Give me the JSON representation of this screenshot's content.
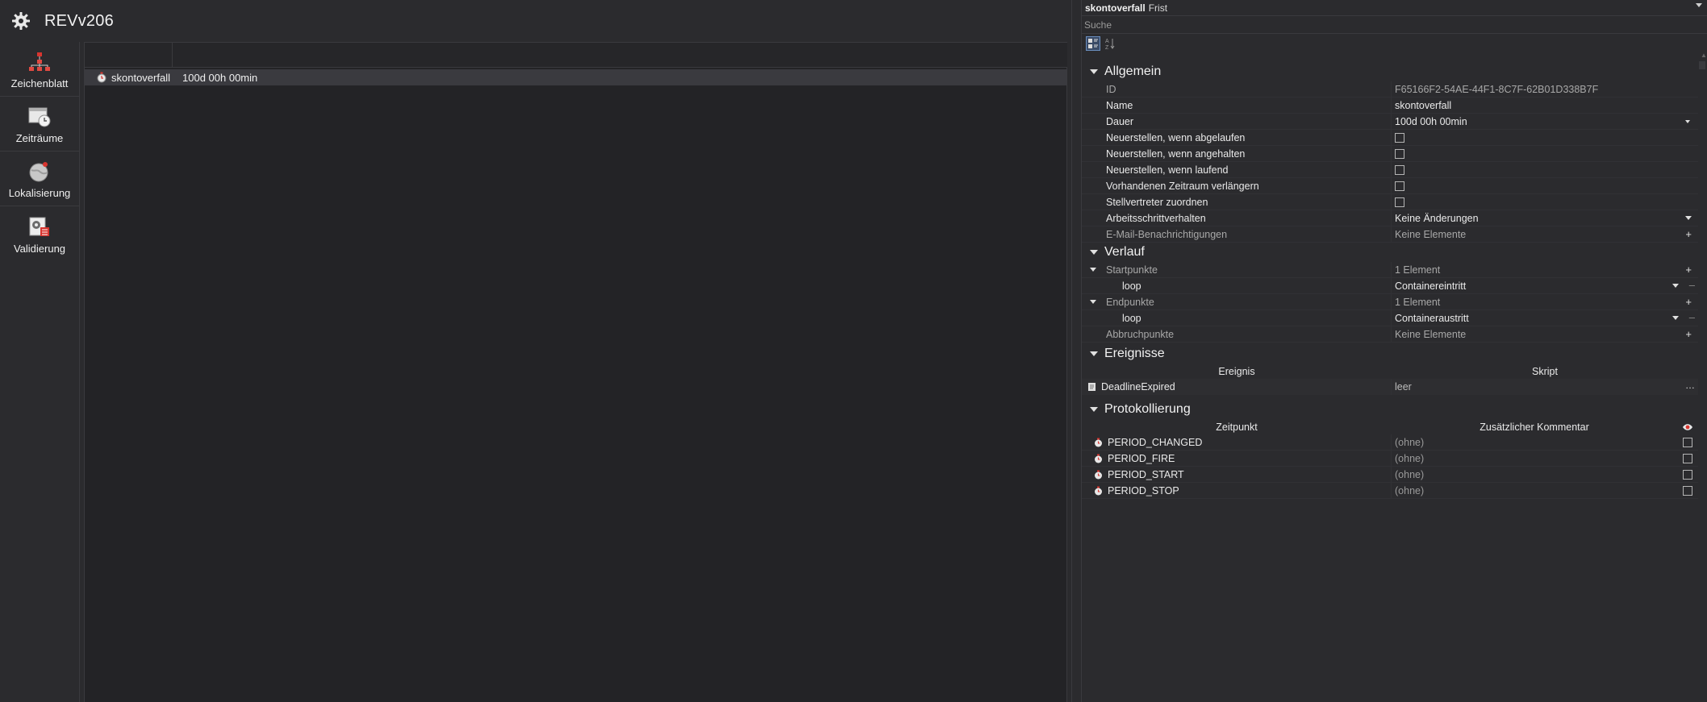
{
  "app": {
    "title": "REVv206"
  },
  "nav": [
    {
      "label": "Zeichenblatt",
      "icon": "diagram-icon"
    },
    {
      "label": "Zeiträume",
      "icon": "calendar-clock-icon"
    },
    {
      "label": "Lokalisierung",
      "icon": "globe-icon"
    },
    {
      "label": "Validierung",
      "icon": "validation-icon"
    }
  ],
  "grid": {
    "rows": [
      {
        "name": "skontoverfall",
        "duration": "100d 00h 00min",
        "icon": "timer-icon"
      }
    ]
  },
  "panel": {
    "title_bold": "skontoverfall",
    "title_sub": "Frist",
    "search_placeholder": "Suche",
    "sections": {
      "allgemein": "Allgemein",
      "verlauf": "Verlauf",
      "ereignisse": "Ereignisse",
      "protokollierung": "Protokollierung"
    },
    "allgemein": {
      "id_label": "ID",
      "id_value": "F65166F2-54AE-44F1-8C7F-62B01D338B7F",
      "name_label": "Name",
      "name_value": "skontoverfall",
      "dauer_label": "Dauer",
      "dauer_value": "100d 00h 00min",
      "neu_abgelaufen": "Neuerstellen, wenn abgelaufen",
      "neu_angehalten": "Neuerstellen, wenn angehalten",
      "neu_laufend": "Neuerstellen, wenn laufend",
      "verlaengern": "Vorhandenen Zeitraum verlängern",
      "stellvertreter": "Stellvertreter zuordnen",
      "arbeitsschritt_label": "Arbeitsschrittverhalten",
      "arbeitsschritt_value": "Keine Änderungen",
      "email_label": "E-Mail-Benachrichtigungen",
      "email_value": "Keine Elemente"
    },
    "verlauf": {
      "start_label": "Startpunkte",
      "start_value": "1 Element",
      "start_item_label": "loop",
      "start_item_value": "Containereintritt",
      "end_label": "Endpunkte",
      "end_value": "1 Element",
      "end_item_label": "loop",
      "end_item_value": "Containeraustritt",
      "abbruch_label": "Abbruchpunkte",
      "abbruch_value": "Keine Elemente"
    },
    "ereignisse": {
      "col_event": "Ereignis",
      "col_script": "Skript",
      "rows": [
        {
          "event": "DeadlineExpired",
          "script": "leer"
        }
      ]
    },
    "protokollierung": {
      "col_time": "Zeitpunkt",
      "col_comment": "Zusätzlicher Kommentar",
      "rows": [
        {
          "name": "PERIOD_CHANGED",
          "comment": "(ohne)"
        },
        {
          "name": "PERIOD_FIRE",
          "comment": "(ohne)"
        },
        {
          "name": "PERIOD_START",
          "comment": "(ohne)"
        },
        {
          "name": "PERIOD_STOP",
          "comment": "(ohne)"
        }
      ]
    }
  }
}
